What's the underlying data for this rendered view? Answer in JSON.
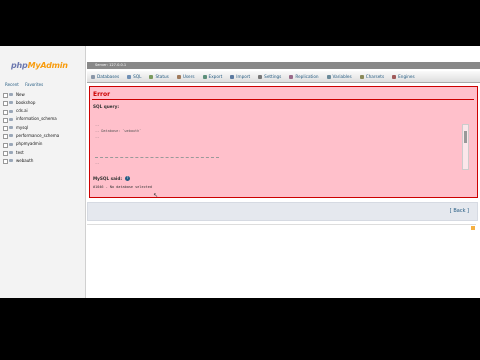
{
  "left_panel": {
    "logo_php": "php",
    "logo_myadmin": "MyAdmin",
    "tabs": [
      "Recent",
      "Favorites"
    ],
    "databases": [
      "New",
      "bookshop",
      "cds.ai",
      "information_schema",
      "mysql",
      "performance_schema",
      "phpmyadmin",
      "test",
      "webauth"
    ]
  },
  "server_bar": {
    "text": "Server: 127.0.0.1"
  },
  "menu": {
    "tabs": [
      {
        "label": "Databases",
        "icon": "database-icon",
        "color": "#8a97a8"
      },
      {
        "label": "SQL",
        "icon": "sql-icon",
        "color": "#6f8fb5"
      },
      {
        "label": "Status",
        "icon": "status-icon",
        "color": "#7a9a5e"
      },
      {
        "label": "Users",
        "icon": "users-icon",
        "color": "#a07a5c"
      },
      {
        "label": "Export",
        "icon": "export-icon",
        "color": "#5c8f7a"
      },
      {
        "label": "Import",
        "icon": "import-icon",
        "color": "#5c7aa0"
      },
      {
        "label": "Settings",
        "icon": "settings-icon",
        "color": "#777777"
      },
      {
        "label": "Replication",
        "icon": "replication-icon",
        "color": "#9a6a8a"
      },
      {
        "label": "Variables",
        "icon": "variables-icon",
        "color": "#6a8a9a"
      },
      {
        "label": "Charsets",
        "icon": "charsets-icon",
        "color": "#8a8a5a"
      },
      {
        "label": "Engines",
        "icon": "engines-icon",
        "color": "#a05a5a"
      }
    ]
  },
  "error": {
    "title": "Error",
    "sql_query_label": "SQL query:",
    "code_lines": [
      "--",
      "-- Database: `webauth`",
      "--"
    ],
    "code_bottom": "--",
    "mysql_said_label": "MySQL said:",
    "mysql_message": "#1046 - No database selected"
  },
  "back": {
    "label": "[ Back ]"
  },
  "colors": {
    "error_bg": "#ffc0cb",
    "error_border": "#cc0000",
    "link": "#235a81"
  }
}
